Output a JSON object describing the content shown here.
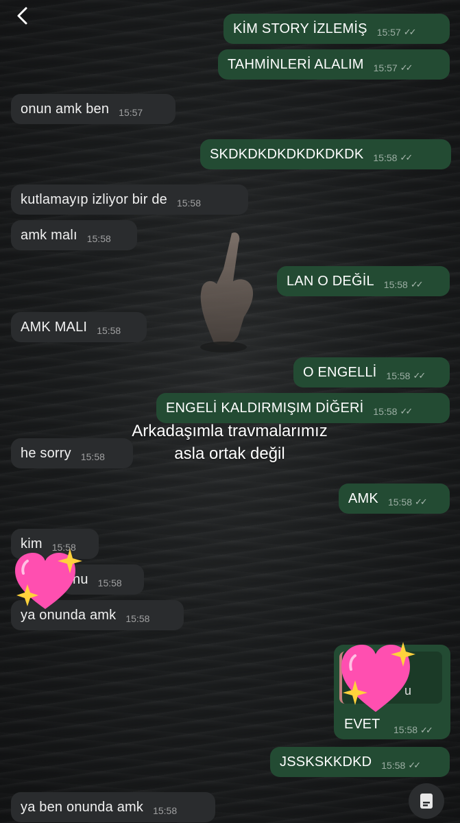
{
  "chat": {
    "back_icon": "chevron-left-icon",
    "messages": [
      {
        "text": "KİM STORY İZLEMİŞ",
        "time": "15:57",
        "dir": "out",
        "ticks": "✓✓"
      },
      {
        "text": "TAHMİNLERİ ALALIM",
        "time": "15:57",
        "dir": "out",
        "ticks": "✓✓"
      },
      {
        "text": "onun amk ben",
        "time": "15:57",
        "dir": "in"
      },
      {
        "text": "SKDKDKDKDKDKDKDK",
        "time": "15:58",
        "dir": "out",
        "ticks": "✓✓"
      },
      {
        "text": "kutlamayıp izliyor bir de",
        "time": "15:58",
        "dir": "in"
      },
      {
        "text": "amk malı",
        "time": "15:58",
        "dir": "in"
      },
      {
        "text": "LAN O DEĞİL",
        "time": "15:58",
        "dir": "out",
        "ticks": "✓✓"
      },
      {
        "text": "AMK MALI",
        "time": "15:58",
        "dir": "in"
      },
      {
        "text": "O ENGELLİ",
        "time": "15:58",
        "dir": "out",
        "ticks": "✓✓"
      },
      {
        "text": "ENGELİ KALDIRMIŞIM DİĞERİ",
        "time": "15:58",
        "dir": "out",
        "ticks": "✓✓"
      },
      {
        "text": "he sorry",
        "time": "15:58",
        "dir": "in"
      },
      {
        "text": "AMK",
        "time": "15:58",
        "dir": "out",
        "ticks": "✓✓"
      },
      {
        "text": "kim",
        "time": "15:58",
        "dir": "in"
      },
      {
        "text": "nu",
        "time": "15:58",
        "dir": "in"
      },
      {
        "text": "ya onunda amk",
        "time": "15:58",
        "dir": "in"
      },
      {
        "text": "JSSKSKKDKD",
        "time": "15:58",
        "dir": "out",
        "ticks": "✓✓"
      },
      {
        "text": "ya ben onunda amk",
        "time": "15:58",
        "dir": "in"
      }
    ],
    "reply": {
      "quote_fragment": "u",
      "text": "EVET",
      "time": "15:58",
      "ticks": "✓✓"
    }
  },
  "overlay": {
    "line1": "Arkadaşımla travmalarımız",
    "line2": "asla ortak değil"
  },
  "decorations": {
    "sticker": "sparkling-heart-icon",
    "doc_button_icon": "document-icon"
  },
  "colors": {
    "outgoing": "#234b33",
    "incoming": "#2a2c2e",
    "heart": "#ff4fb0"
  }
}
